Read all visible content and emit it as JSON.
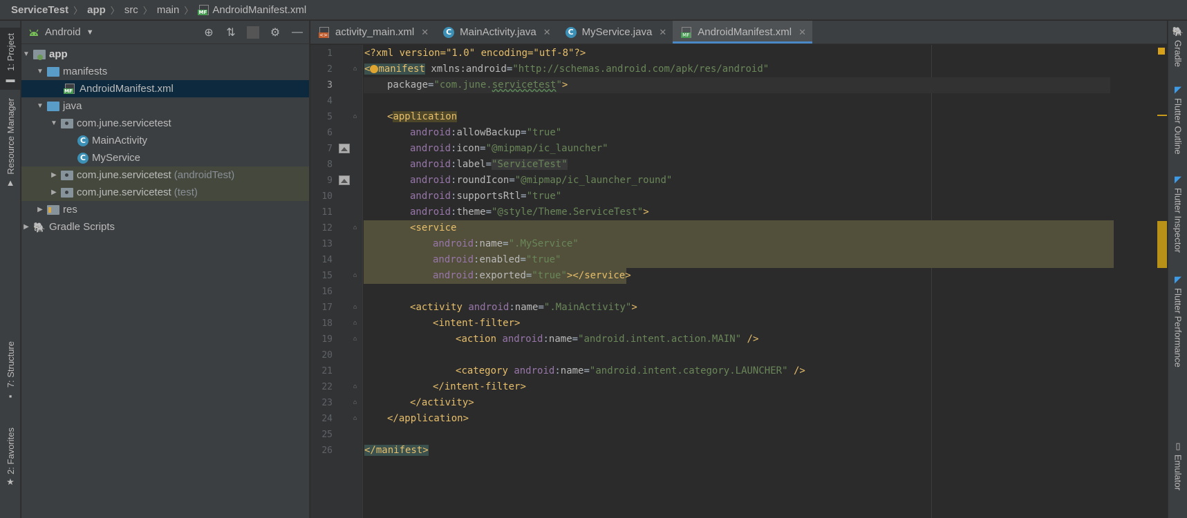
{
  "breadcrumb": [
    {
      "label": "ServiceTest",
      "bold": true
    },
    {
      "label": "app",
      "bold": true
    },
    {
      "label": "src",
      "bold": false
    },
    {
      "label": "main",
      "bold": false
    },
    {
      "label": "AndroidManifest.xml",
      "bold": false,
      "icon": "manifest-file-icon"
    }
  ],
  "left_strip": {
    "project": "1: Project",
    "resource_manager": "Resource Manager",
    "structure": "7: Structure",
    "favorites": "2: Favorites"
  },
  "right_strip": {
    "gradle": "Gradle",
    "flutter_outline": "Flutter Outline",
    "flutter_inspector": "Flutter Inspector",
    "flutter_performance": "Flutter Performance",
    "emulator": "Emulator"
  },
  "project_panel": {
    "view_mode": "Android",
    "tree": {
      "app": "app",
      "manifests": "manifests",
      "manifest_file": "AndroidManifest.xml",
      "java": "java",
      "pkg_main": "com.june.servicetest",
      "main_activity": "MainActivity",
      "my_service": "MyService",
      "pkg_android_test": "com.june.servicetest",
      "pkg_android_test_suffix": "(androidTest)",
      "pkg_test": "com.june.servicetest",
      "pkg_test_suffix": "(test)",
      "res": "res",
      "gradle_scripts": "Gradle Scripts"
    }
  },
  "tabs": [
    {
      "label": "activity_main.xml",
      "icon": "layout-xml-icon",
      "active": false
    },
    {
      "label": "MainActivity.java",
      "icon": "class-icon",
      "active": false
    },
    {
      "label": "MyService.java",
      "icon": "class-icon",
      "active": false
    },
    {
      "label": "AndroidManifest.xml",
      "icon": "manifest-file-icon",
      "active": true
    }
  ],
  "editor": {
    "line_numbers": [
      "1",
      "2",
      "3",
      "4",
      "5",
      "6",
      "7",
      "8",
      "9",
      "10",
      "11",
      "12",
      "13",
      "14",
      "15",
      "16",
      "17",
      "18",
      "19",
      "20",
      "21",
      "22",
      "23",
      "24",
      "25",
      "26"
    ],
    "code": {
      "l1": "<?xml version=\"1.0\" encoding=\"utf-8\"?>",
      "l2_tag": "manifest",
      "l2_ns": "xmlns:android",
      "l2_val": "\"http://schemas.android.com/apk/res/android\"",
      "l3_attr": "package",
      "l3_val_a": "\"com.june.",
      "l3_val_b": "servicetest",
      "l3_val_c": "\"",
      "l5_tag": "application",
      "l6_attr": "allowBackup",
      "l6_val": "\"true\"",
      "l7_attr": "icon",
      "l7_val": "\"@mipmap/ic_launcher\"",
      "l8_attr": "label",
      "l8_val": "\"ServiceTest\"",
      "l9_attr": "roundIcon",
      "l9_val": "\"@mipmap/ic_launcher_round\"",
      "l10_attr": "supportsRtl",
      "l10_val": "\"true\"",
      "l11_attr": "theme",
      "l11_val": "\"@style/Theme.ServiceTest\"",
      "l12_tag": "service",
      "l13_attr": "name",
      "l13_val": "\".MyService\"",
      "l14_attr": "enabled",
      "l14_val": "\"true\"",
      "l15_attr": "exported",
      "l15_val": "\"true\"",
      "l15_end": "service",
      "l17_tag": "activity",
      "l17_attr": "name",
      "l17_val": "\".MainActivity\"",
      "l18_tag": "intent-filter",
      "l19_tag": "action",
      "l19_attr": "name",
      "l19_val": "\"android.intent.action.MAIN\"",
      "l21_tag": "category",
      "l21_attr": "name",
      "l21_val": "\"android.intent.category.LAUNCHER\"",
      "l22_tag": "intent-filter",
      "l23_tag": "activity",
      "l24_tag": "application",
      "l26_tag": "manifest",
      "ns": "android"
    }
  },
  "colors": {
    "tag": "#e8bf6a",
    "namespace": "#9876aa",
    "value": "#6a8759",
    "selection": "#0d293e",
    "tab_underline": "#4a88c7"
  }
}
